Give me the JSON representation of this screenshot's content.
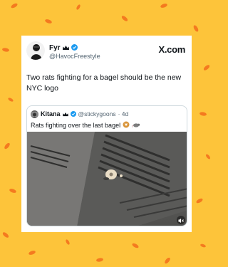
{
  "tweet": {
    "author_name": "Fyr",
    "author_handle": "@HavocFreestyle",
    "text": "Two rats fighting for a bagel should be the new NYC logo",
    "source_logo": "X.com"
  },
  "quoted_tweet": {
    "author_name": "Kitana",
    "author_handle": "@stickygoons",
    "time": "· 4d",
    "text": "Rats fighting over the last bagel"
  },
  "icons": {
    "badge": "crown-badge-icon",
    "verified": "verified-check-icon",
    "bagel_emoji": "bagel-icon",
    "rat_emoji": "rat-icon",
    "mute": "speaker-mute-icon"
  },
  "colors": {
    "background": "#fdc43a",
    "dots": "#f47a1f",
    "verified": "#1d9bf0",
    "text": "#0f1419",
    "muted_text": "#536471"
  }
}
